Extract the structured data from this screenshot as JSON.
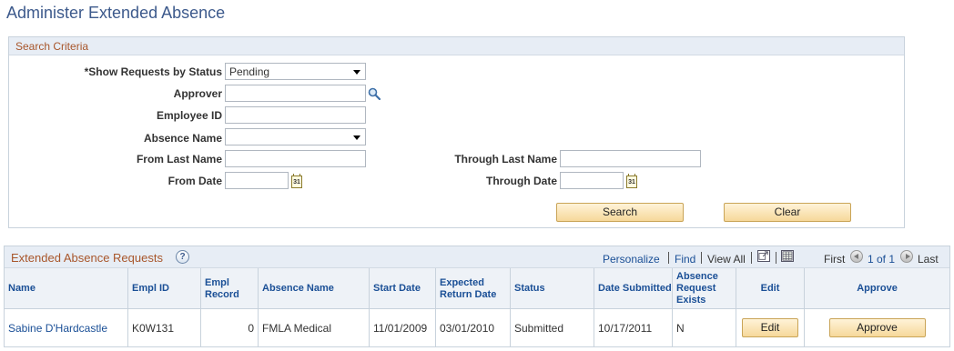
{
  "page": {
    "title": "Administer Extended Absence"
  },
  "search": {
    "header": "Search Criteria",
    "show_requests_label": "*Show Requests by Status",
    "show_requests_value": "Pending",
    "approver_label": "Approver",
    "approver_value": "",
    "employee_id_label": "Employee ID",
    "employee_id_value": "",
    "absence_name_label": "Absence Name",
    "absence_name_value": "",
    "from_last_name_label": "From Last Name",
    "from_last_name_value": "",
    "through_last_name_label": "Through Last Name",
    "through_last_name_value": "",
    "from_date_label": "From Date",
    "from_date_value": "",
    "through_date_label": "Through Date",
    "through_date_value": "",
    "search_button": "Search",
    "clear_button": "Clear",
    "calendar_glyph": "31"
  },
  "grid": {
    "title": "Extended Absence Requests",
    "help_glyph": "?",
    "personalize": "Personalize",
    "find": "Find",
    "view_all": "View All",
    "first": "First",
    "page_range": "1 of 1",
    "last": "Last",
    "columns": [
      "Name",
      "Empl ID",
      "Empl Record",
      "Absence Name",
      "Start Date",
      "Expected Return Date",
      "Status",
      "Date Submitted",
      "Absence Request Exists",
      "Edit",
      "Approve"
    ],
    "rows": [
      {
        "name": "Sabine D'Hardcastle",
        "empl_id": "K0W131",
        "empl_record": "0",
        "absence_name": "FMLA Medical",
        "start_date": "11/01/2009",
        "expected_return_date": "03/01/2010",
        "status": "Submitted",
        "date_submitted": "10/17/2011",
        "absence_request_exists": "N",
        "edit_button": "Edit",
        "approve_button": "Approve"
      }
    ]
  },
  "colors": {
    "title": "#3d5a8c",
    "section_header_text": "#a8562b",
    "link": "#1a4f96",
    "button_fill": "#f6d89a"
  },
  "icons": {
    "approver_lookup": "magnifier-icon",
    "calendar": "calendar-icon",
    "help": "help-icon",
    "zoom": "new-window-icon",
    "download": "spreadsheet-icon",
    "prev": "arrow-left-icon",
    "next": "arrow-right-icon"
  }
}
